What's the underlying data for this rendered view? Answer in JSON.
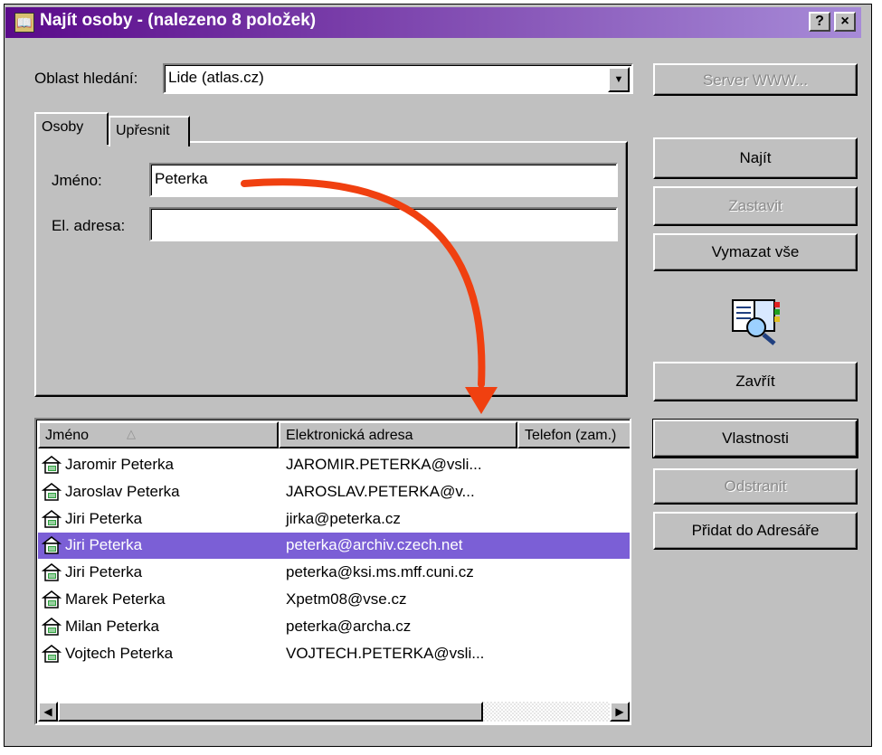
{
  "window": {
    "title": "Najít osoby - (nalezeno 8 položek)",
    "help_btn": "?",
    "close_btn": "×"
  },
  "search_area": {
    "label": "Oblast hledání:",
    "value": "Lide (atlas.cz)"
  },
  "tabs": [
    {
      "label": "Osoby"
    },
    {
      "label": "Upřesnit"
    }
  ],
  "form": {
    "name_label": "Jméno:",
    "name_value": "Peterka",
    "email_label": "El. adresa:",
    "email_value": ""
  },
  "buttons": {
    "server_www": "Server WWW...",
    "find": "Najít",
    "stop": "Zastavit",
    "clear_all": "Vymazat vše",
    "close": "Zavřít",
    "properties": "Vlastnosti",
    "remove": "Odstranit",
    "add_to_addressbook": "Přidat do Adresáře"
  },
  "results": {
    "columns": [
      "Jméno",
      "Elektronická adresa",
      "Telefon (zam.)"
    ],
    "rows": [
      {
        "name": "Jaromir Peterka",
        "email": "JAROMIR.PETERKA@vsli..."
      },
      {
        "name": "Jaroslav Peterka",
        "email": "JAROSLAV.PETERKA@v..."
      },
      {
        "name": "Jiri Peterka",
        "email": "jirka@peterka.cz"
      },
      {
        "name": "Jiri Peterka",
        "email": "peterka@archiv.czech.net"
      },
      {
        "name": "Jiri Peterka",
        "email": "peterka@ksi.ms.mff.cuni.cz"
      },
      {
        "name": "Marek Peterka",
        "email": "Xpetm08@vse.cz"
      },
      {
        "name": "Milan Peterka",
        "email": "peterka@archa.cz"
      },
      {
        "name": "Vojtech Peterka",
        "email": "VOJTECH.PETERKA@vsli..."
      }
    ],
    "selected_row": 4
  },
  "colors": {
    "titlebar_start": "#5a0a8a",
    "selection": "#7b5fd6",
    "annotation_arrow": "#f04010"
  }
}
